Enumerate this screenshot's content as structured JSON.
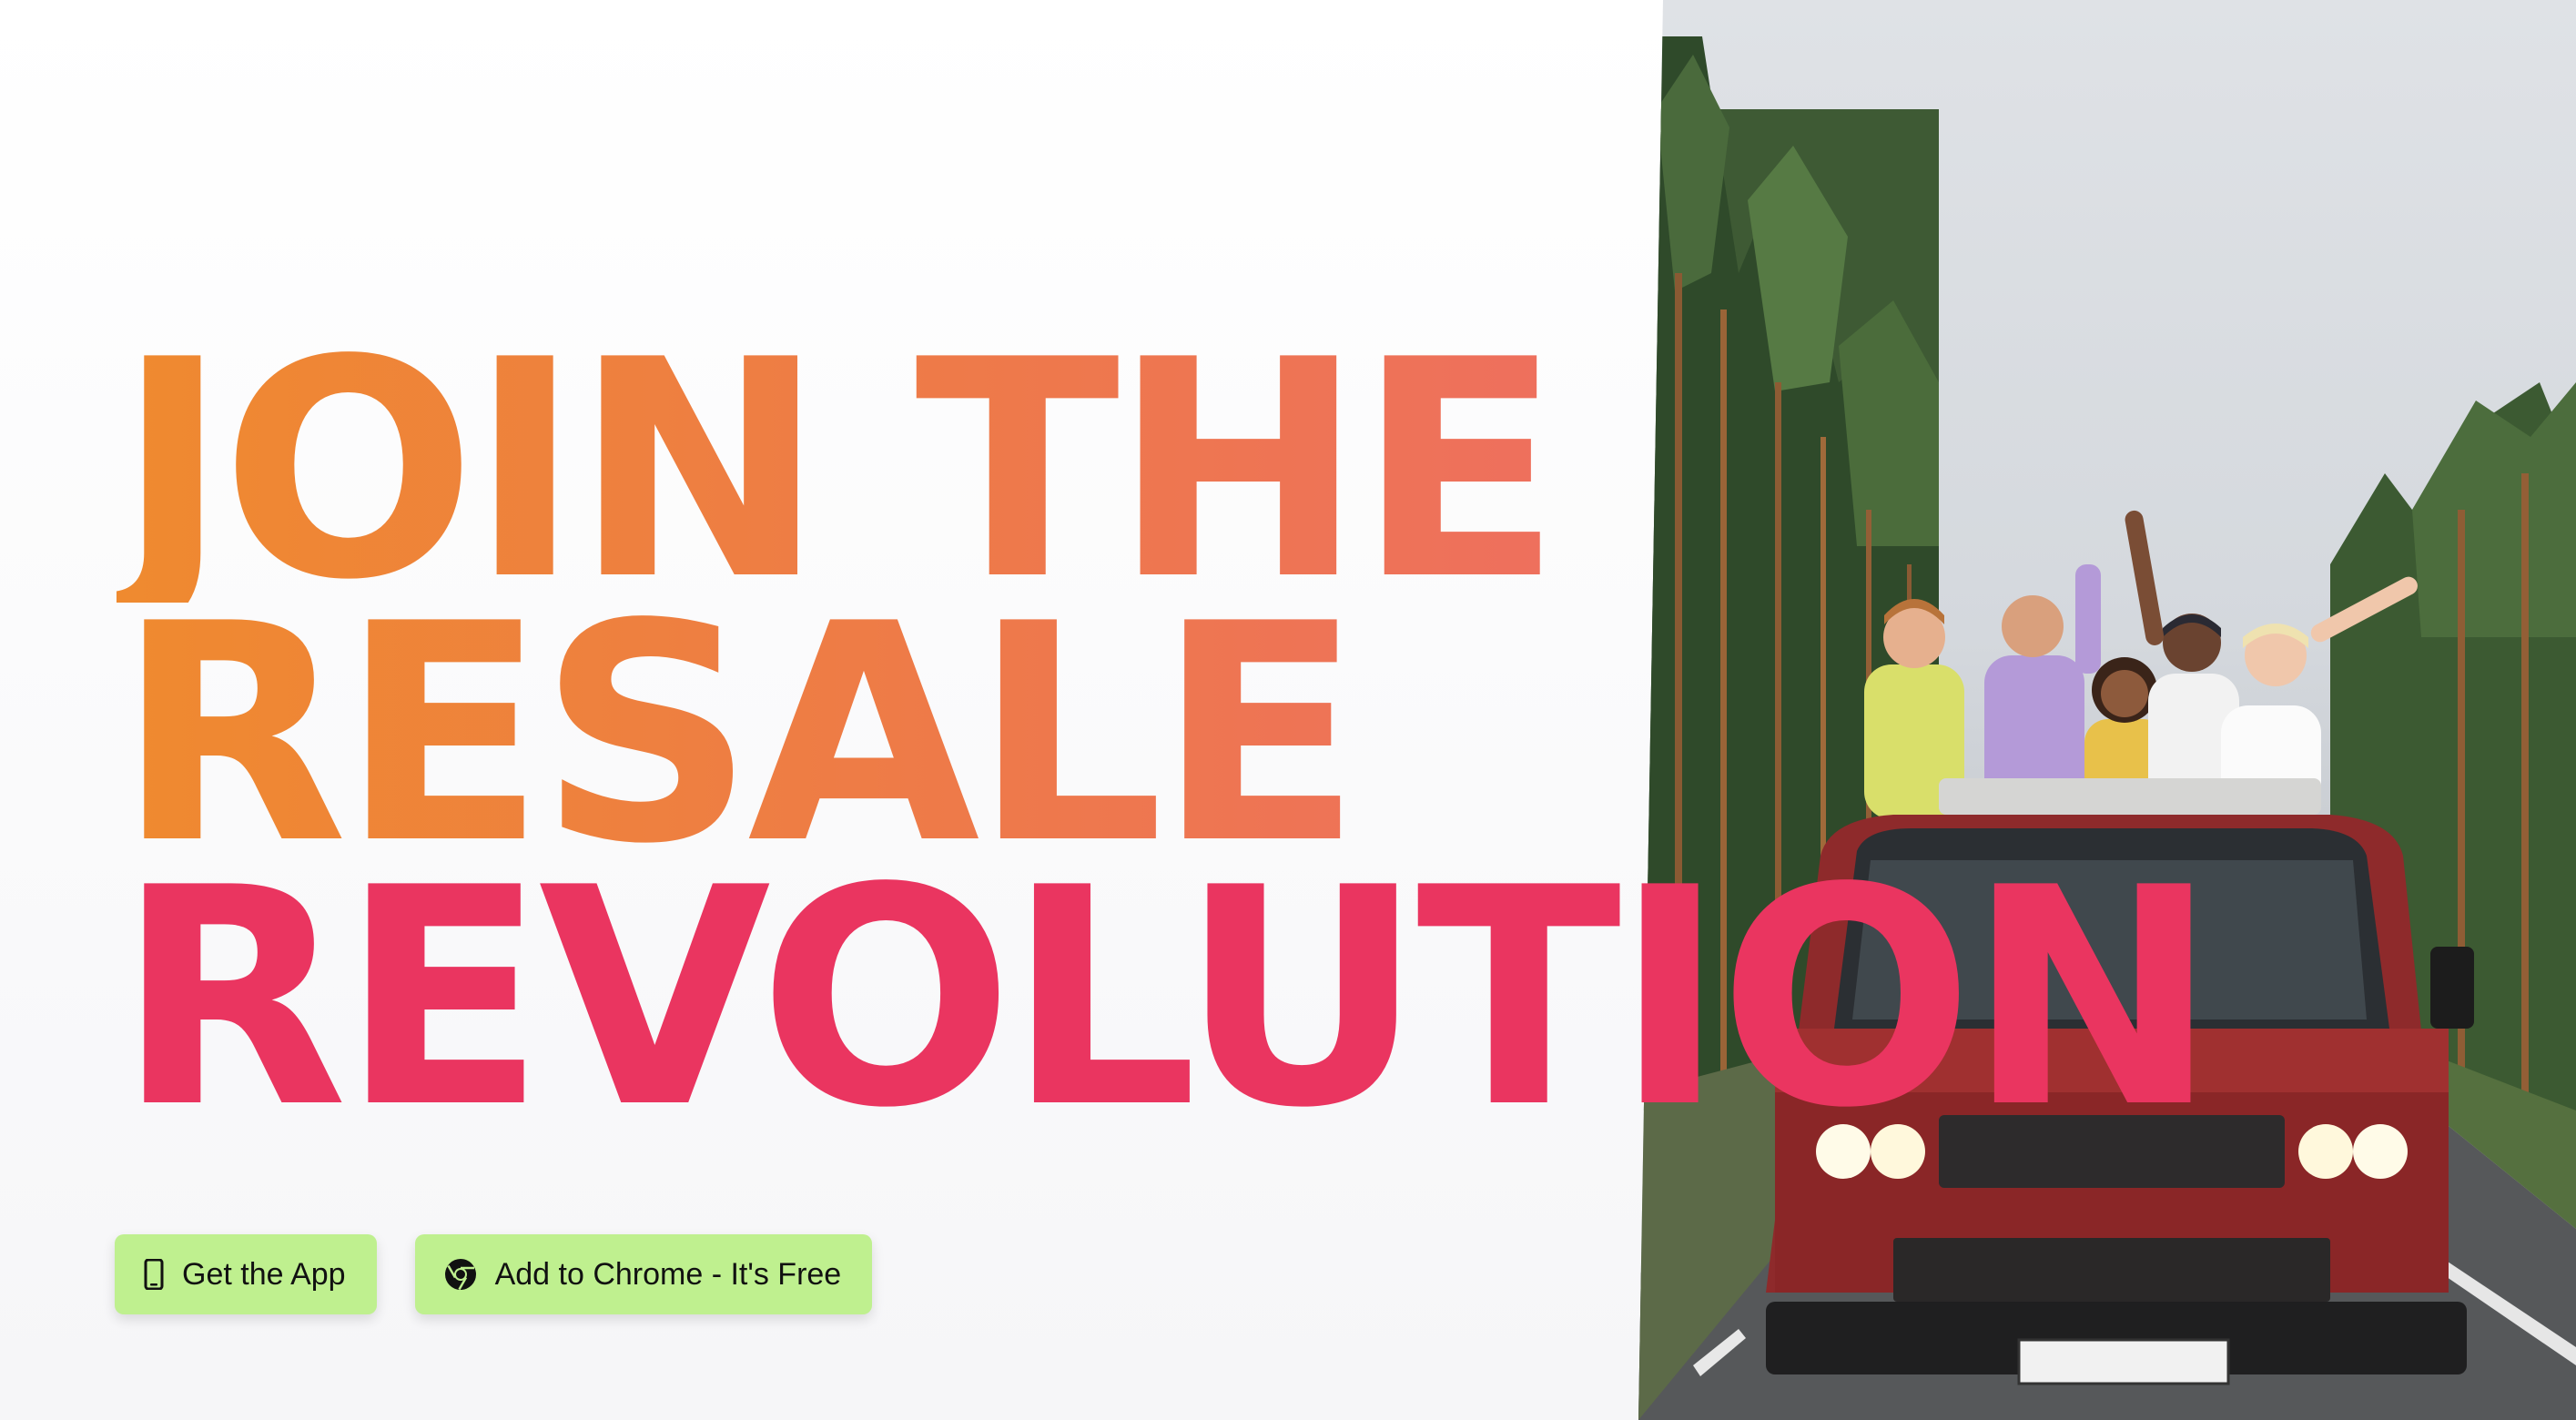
{
  "hero": {
    "headline_line1": "JOIN THE",
    "headline_line2": "RESALE",
    "headline_line3": "REVOLUTION"
  },
  "buttons": {
    "get_app": {
      "label": "Get the App",
      "icon": "smartphone-icon"
    },
    "add_chrome": {
      "label": "Add to Chrome - It's Free",
      "icon": "chrome-icon"
    }
  },
  "colors": {
    "gradient_start": "#ef8a2f",
    "gradient_end": "#ed6474",
    "revolution_pink": "#ea3560",
    "button_green": "#bff08f"
  },
  "hero_image": {
    "subject": "friends standing through the sunroof of a red van on a forest road"
  }
}
